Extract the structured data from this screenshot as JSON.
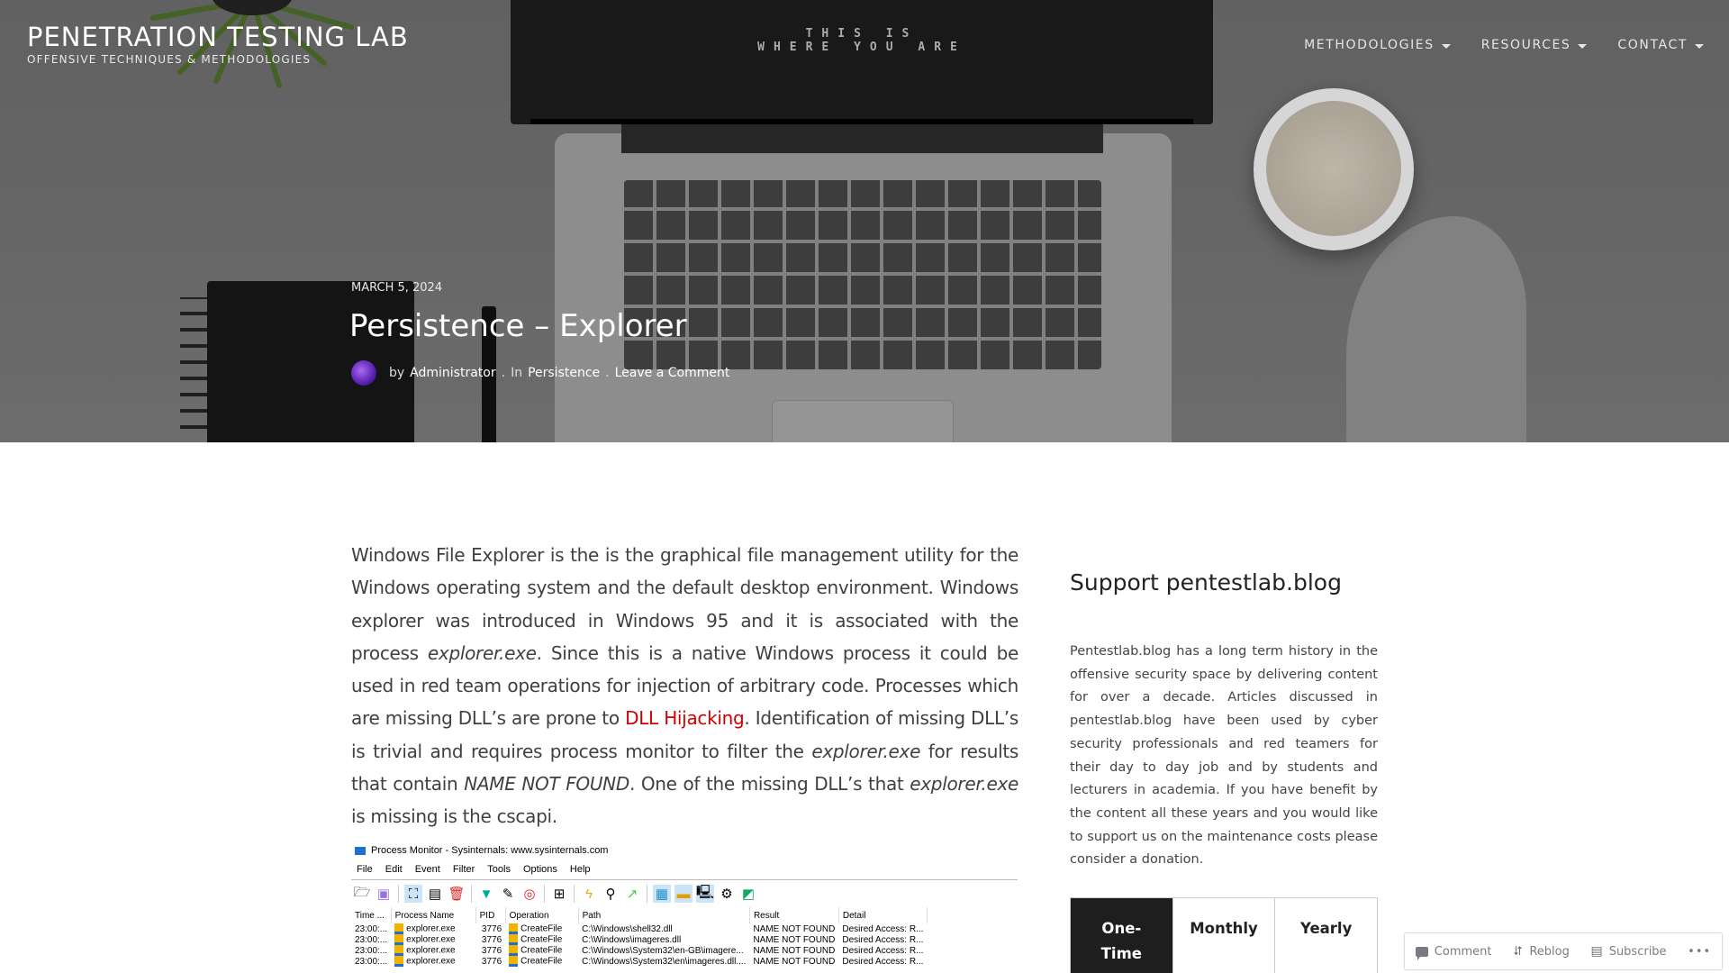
{
  "site": {
    "title": "PENETRATION TESTING LAB",
    "tagline": "OFFENSIVE TECHNIQUES & METHODOLOGIES"
  },
  "nav": {
    "items": [
      {
        "label": "METHODOLOGIES"
      },
      {
        "label": "RESOURCES"
      },
      {
        "label": "CONTACT"
      }
    ]
  },
  "hero": {
    "screen_text_1": "THIS IS",
    "screen_text_2": "WHERE YOU ARE"
  },
  "post": {
    "date": "MARCH 5, 2024",
    "title": "Persistence – Explorer",
    "by": "by",
    "author": "Administrator",
    "in": "In",
    "category": "Persistence",
    "comment_link": "Leave a Comment"
  },
  "entry": {
    "p1_a": "Windows File Explorer is the is the graphical file management utility for the Windows operating system and the default desktop environment. Windows explorer was introduced in Windows 95 and it is associated with the process ",
    "p1_em1": "explorer.exe",
    "p1_b": ". Since this is a native Windows process it could be used in red team operations for injection of arbitrary code. Processes which are missing DLL’s are prone to ",
    "p1_link": "DLL Hijacking",
    "p1_c": ". Identification of missing DLL’s is trivial and requires process monitor to filter the ",
    "p1_em2": "explorer.exe",
    "p1_d": " for results that contain ",
    "p1_em3": "NAME NOT FOUND",
    "p1_e": ". One of the missing DLL’s that ",
    "p1_em4": "explorer.exe",
    "p1_f": " is missing is the cscapi."
  },
  "procmon": {
    "title": "Process Monitor - Sysinternals: www.sysinternals.com",
    "menu": [
      "File",
      "Edit",
      "Event",
      "Filter",
      "Tools",
      "Options",
      "Help"
    ],
    "columns": [
      "Time ...",
      "Process Name",
      "PID",
      "Operation",
      "Path",
      "Result",
      "Detail"
    ],
    "rows": [
      {
        "time": "23:00:...",
        "process": "explorer.exe",
        "pid": "3776",
        "operation": "CreateFile",
        "path": "C:\\Windows\\shell32.dll",
        "result": "NAME NOT FOUND",
        "detail": "Desired Access: R..."
      },
      {
        "time": "23:00:...",
        "process": "explorer.exe",
        "pid": "3776",
        "operation": "CreateFile",
        "path": "C:\\Windows\\imageres.dll",
        "result": "NAME NOT FOUND",
        "detail": "Desired Access: R..."
      },
      {
        "time": "23:00:...",
        "process": "explorer.exe",
        "pid": "3776",
        "operation": "CreateFile",
        "path": "C:\\Windows\\System32\\en-GB\\imagere...",
        "result": "NAME NOT FOUND",
        "detail": "Desired Access: R..."
      },
      {
        "time": "23:00:...",
        "process": "explorer.exe",
        "pid": "3776",
        "operation": "CreateFile",
        "path": "C:\\Windows\\System32\\en\\imageres.dll....",
        "result": "NAME NOT FOUND",
        "detail": "Desired Access: R..."
      }
    ]
  },
  "sidebar": {
    "widget_title": "Support pentestlab.blog",
    "widget_text": "Pentestlab.blog has a long term history in the offensive security space by delivering content for over a decade. Articles discussed in pentestlab.blog have been used by cyber security professionals and red teamers for their day to day job and by students and lecturers in academia. If you have benefit by the content all these years and you would like to support us on the maintenance costs please consider a donation.",
    "donation_tabs": [
      {
        "label": "One-Time",
        "active": true
      },
      {
        "label": "Monthly",
        "active": false
      },
      {
        "label": "Yearly",
        "active": false
      }
    ]
  },
  "actionbar": {
    "comment": "Comment",
    "reblog": "Reblog",
    "subscribe": "Subscribe",
    "more": "•••"
  },
  "colors": {
    "link_red": "#d00000",
    "text": "#404040",
    "active_tab_bg": "#1e1e1e"
  }
}
